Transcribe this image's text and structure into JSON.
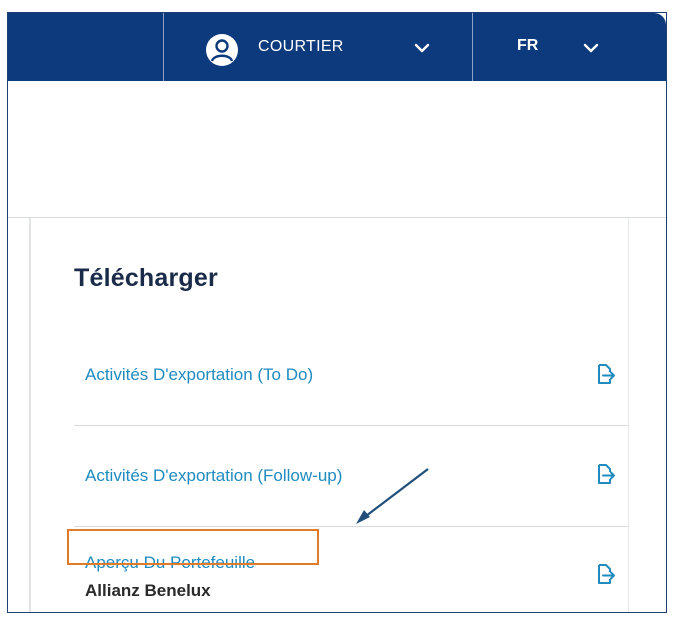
{
  "header": {
    "user_role": "COURTIER",
    "language": "FR"
  },
  "icons": {
    "avatar": "user-avatar-icon",
    "dropdown": "chevron-down-icon",
    "export": "export-file-icon"
  },
  "colors": {
    "header_bg": "#0d3a7c",
    "link": "#1f8bbf",
    "highlight": "#e07b2a",
    "annotation_arrow": "#1f4f7a"
  },
  "download": {
    "title": "Télécharger",
    "items": [
      {
        "label": "Activités D'exportation (To Do)"
      },
      {
        "label": "Activités D'exportation (Follow-up)"
      },
      {
        "label": "Aperçu Du Portefeuille",
        "sublabel": "Allianz Benelux"
      }
    ]
  }
}
